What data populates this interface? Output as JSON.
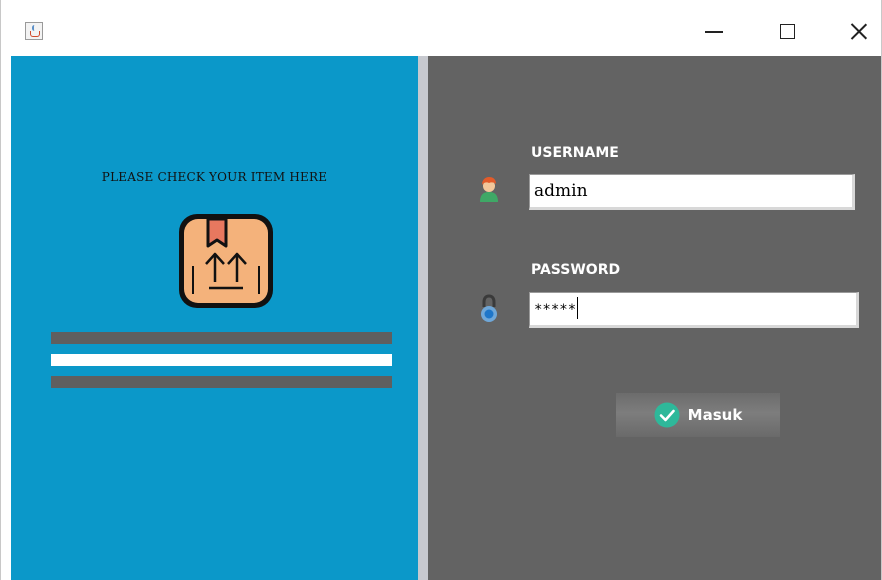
{
  "window": {
    "minimize_icon": "minimize-icon",
    "maximize_icon": "maximize-icon",
    "close_icon": "close-icon"
  },
  "left": {
    "tagline": "PLEASE CHECK YOUR ITEM HERE",
    "icon": "package-box-icon",
    "background_color": "#0b98c9"
  },
  "form": {
    "username_label": "USERNAME",
    "username_value": "admin",
    "username_icon": "user-icon",
    "password_label": "PASSWORD",
    "password_value": "*****",
    "password_icon": "lock-icon",
    "submit_label": "Masuk",
    "submit_icon": "check-circle-icon",
    "panel_color": "#636363",
    "accent_color": "#2eb89a"
  }
}
